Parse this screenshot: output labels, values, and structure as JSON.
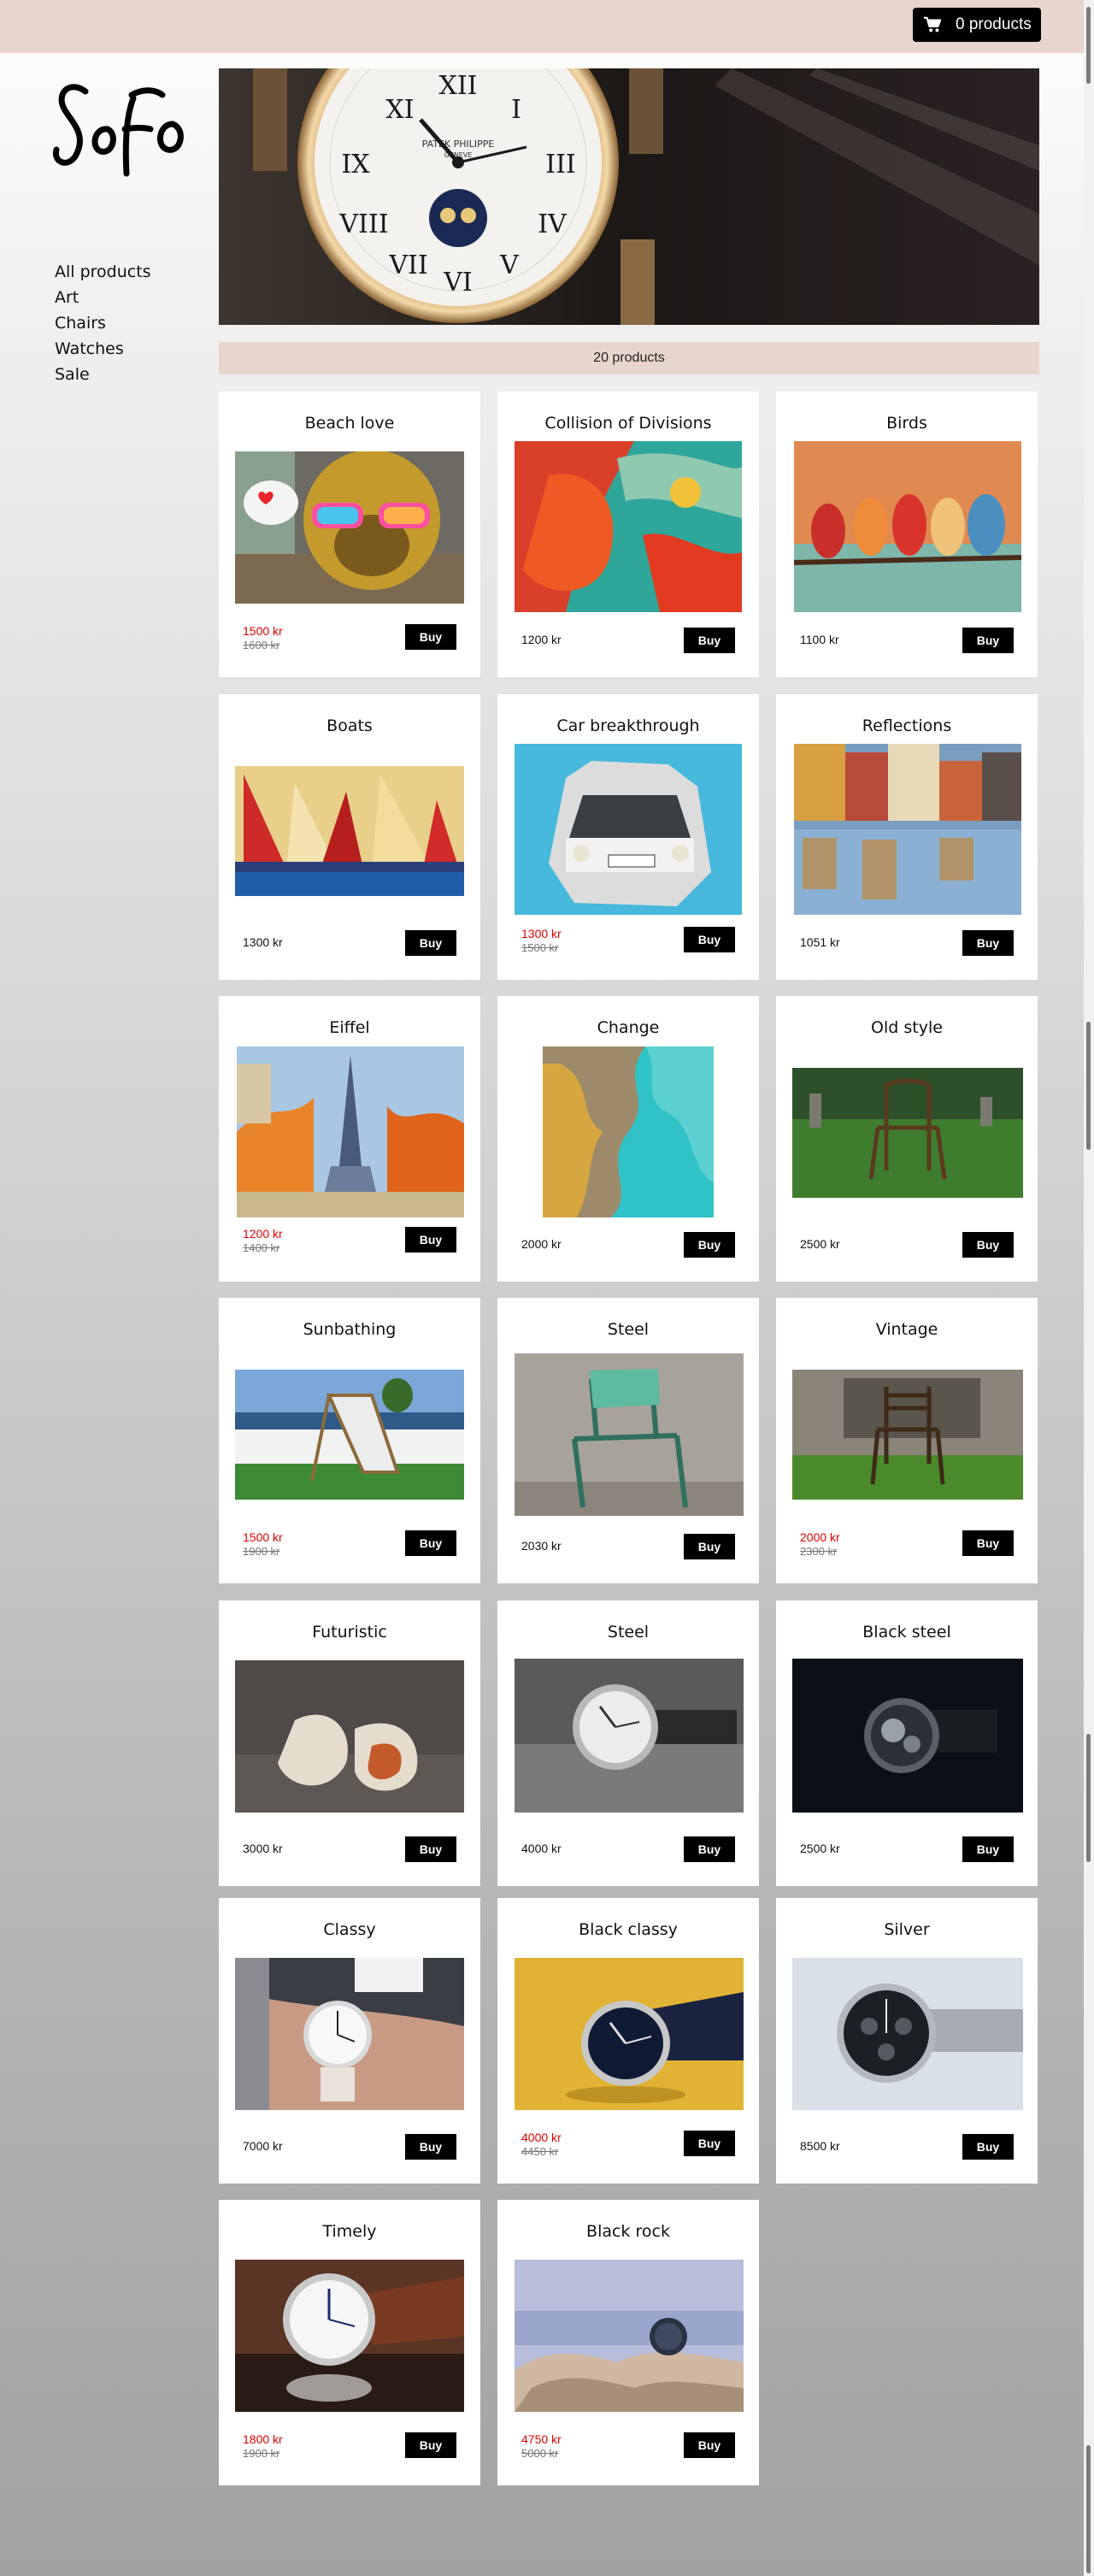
{
  "header": {
    "cart_label": "0 products"
  },
  "logo": "SoFo",
  "nav": [
    "All products",
    "Art",
    "Chairs",
    "Watches",
    "Sale"
  ],
  "catalog": {
    "count_label": "20 products"
  },
  "hero": {
    "dial_brand": "PATEK PHILIPPE",
    "dial_city": "GENEVE"
  },
  "products": [
    {
      "title": "Beach love",
      "price": "1500 kr",
      "old_price": "1600 kr",
      "buy_label": "Buy"
    },
    {
      "title": "Collision of Divisions",
      "price": "1200 kr",
      "old_price": "",
      "buy_label": "Buy"
    },
    {
      "title": "Birds",
      "price": "1100 kr",
      "old_price": "",
      "buy_label": "Buy"
    },
    {
      "title": "Boats",
      "price": "1300 kr",
      "old_price": "",
      "buy_label": "Buy"
    },
    {
      "title": "Car breakthrough",
      "price": "1300 kr",
      "old_price": "1500 kr",
      "buy_label": "Buy"
    },
    {
      "title": "Reflections",
      "price": "1051 kr",
      "old_price": "",
      "buy_label": "Buy"
    },
    {
      "title": "Eiffel",
      "price": "1200 kr",
      "old_price": "1400 kr",
      "buy_label": "Buy"
    },
    {
      "title": "Change",
      "price": "2000 kr",
      "old_price": "",
      "buy_label": "Buy"
    },
    {
      "title": "Old style",
      "price": "2500 kr",
      "old_price": "",
      "buy_label": "Buy"
    },
    {
      "title": "Sunbathing",
      "price": "1500 kr",
      "old_price": "1900 kr",
      "buy_label": "Buy"
    },
    {
      "title": "Steel",
      "price": "2030 kr",
      "old_price": "",
      "buy_label": "Buy"
    },
    {
      "title": "Vintage",
      "price": "2000 kr",
      "old_price": "2300 kr",
      "buy_label": "Buy"
    },
    {
      "title": "Futuristic",
      "price": "3000 kr",
      "old_price": "",
      "buy_label": "Buy"
    },
    {
      "title": "Steel",
      "price": "4000 kr",
      "old_price": "",
      "buy_label": "Buy"
    },
    {
      "title": "Black steel",
      "price": "2500 kr",
      "old_price": "",
      "buy_label": "Buy"
    },
    {
      "title": "Classy",
      "price": "7000 kr",
      "old_price": "",
      "buy_label": "Buy"
    },
    {
      "title": "Black classy",
      "price": "4000 kr",
      "old_price": "4450 kr",
      "buy_label": "Buy"
    },
    {
      "title": "Silver",
      "price": "8500 kr",
      "old_price": "",
      "buy_label": "Buy"
    },
    {
      "title": "Timely",
      "price": "1800 kr",
      "old_price": "1900 kr",
      "buy_label": "Buy"
    },
    {
      "title": "Black rock",
      "price": "4750 kr",
      "old_price": "5000 kr",
      "buy_label": "Buy"
    }
  ],
  "colors": {
    "accent_band": "#e8d6cc",
    "sale_price": "#e00000",
    "button": "#000000"
  },
  "icons": {
    "cart": "cart-icon"
  }
}
